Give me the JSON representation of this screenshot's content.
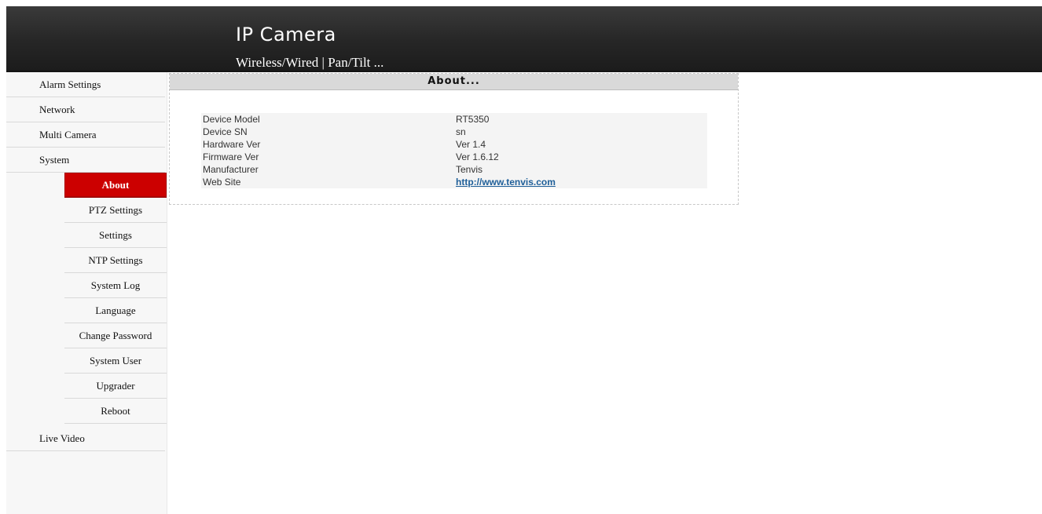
{
  "header": {
    "title": "IP Camera",
    "subtitle": "Wireless/Wired | Pan/Tilt ..."
  },
  "sidebar": {
    "items": [
      {
        "label": "Alarm Settings"
      },
      {
        "label": "Network"
      },
      {
        "label": "Multi Camera"
      },
      {
        "label": "System"
      },
      {
        "label": "Live Video"
      }
    ],
    "system_sub": [
      {
        "label": "About",
        "active": true
      },
      {
        "label": "PTZ Settings"
      },
      {
        "label": "Settings"
      },
      {
        "label": "NTP Settings"
      },
      {
        "label": "System Log"
      },
      {
        "label": "Language"
      },
      {
        "label": "Change Password"
      },
      {
        "label": "System User"
      },
      {
        "label": "Upgrader"
      },
      {
        "label": "Reboot"
      }
    ]
  },
  "about": {
    "heading": "About...",
    "rows": [
      {
        "label": "Device Model",
        "value": "RT5350"
      },
      {
        "label": "Device SN",
        "value": "sn"
      },
      {
        "label": "Hardware Ver",
        "value": "Ver 1.4"
      },
      {
        "label": "Firmware Ver",
        "value": "Ver 1.6.12"
      },
      {
        "label": "Manufacturer",
        "value": "Tenvis"
      },
      {
        "label": "Web Site",
        "value": "http://www.tenvis.com"
      }
    ]
  },
  "colors": {
    "active_nav": "#cc0000",
    "header_bg": "#262626",
    "link": "#1f5f99"
  }
}
